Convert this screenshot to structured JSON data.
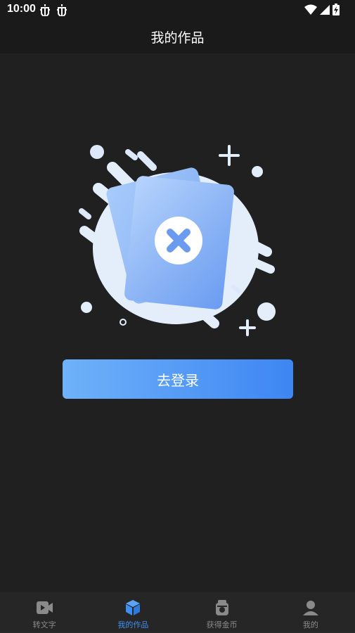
{
  "status_bar": {
    "time": "10:00",
    "icons": [
      "bug-icon",
      "bug-icon",
      "wifi-icon",
      "signal-icon",
      "battery-charging-icon"
    ]
  },
  "header": {
    "title": "我的作品"
  },
  "empty_state": {
    "illustration": "empty-works-cards-x-icon",
    "login_button_label": "去登录",
    "accent_colors": [
      "#6fb2f9",
      "#3d86f3"
    ]
  },
  "tab_bar": {
    "active_color": "#3f8ff2",
    "inactive_color": "#8a8a8a",
    "items": [
      {
        "label": "转文字",
        "icon": "video-icon",
        "active": false
      },
      {
        "label": "我的作品",
        "icon": "cube-icon",
        "active": true
      },
      {
        "label": "获得金币",
        "icon": "coin-machine-icon",
        "active": false
      },
      {
        "label": "我的",
        "icon": "user-icon",
        "active": false
      }
    ]
  }
}
